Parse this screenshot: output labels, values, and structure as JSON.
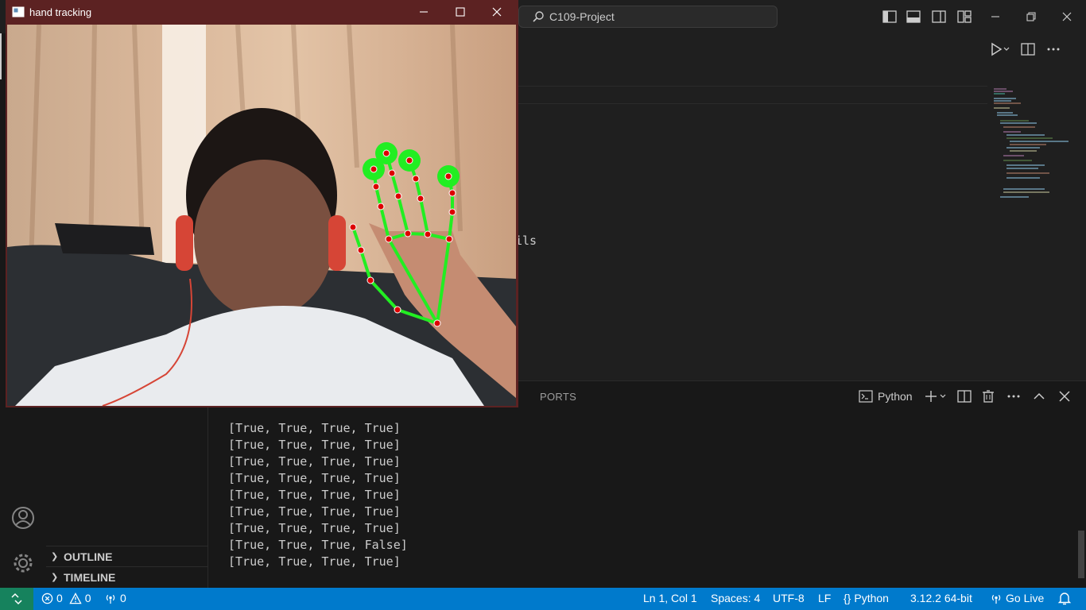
{
  "vscode": {
    "search_label": "C109-Project",
    "code_fragment": "ils"
  },
  "sidebar": {
    "outline_label": "OUTLINE",
    "timeline_label": "TIMELINE"
  },
  "panel": {
    "ports_tab": "PORTS",
    "terminal_profile": "Python",
    "output_lines": [
      "[True, True, True, True]",
      "[True, True, True, True]",
      "[True, True, True, True]",
      "[True, True, True, True]",
      "[True, True, True, True]",
      "[True, True, True, True]",
      "[True, True, True, True]",
      "[True, True, True, False]",
      "[True, True, True, True]"
    ]
  },
  "status_bar": {
    "errors": "0",
    "warnings": "0",
    "ports": "0",
    "cursor": "Ln 1, Col 1",
    "spaces": "Spaces: 4",
    "encoding": "UTF-8",
    "eol": "LF",
    "language": "Python",
    "interpreter": "3.12.2 64-bit",
    "go_live": "Go Live"
  },
  "hand_window": {
    "title": "hand tracking"
  },
  "colors": {
    "status_bar": "#007acc",
    "remote": "#16825d",
    "hand_window_frame": "#5c2222",
    "landmark_line": "#22ee22",
    "landmark_point": "#dd0000"
  },
  "icons": {
    "search": "search-icon",
    "run": "play-icon",
    "account": "account-icon",
    "settings": "gear-icon",
    "bell": "bell-icon"
  }
}
